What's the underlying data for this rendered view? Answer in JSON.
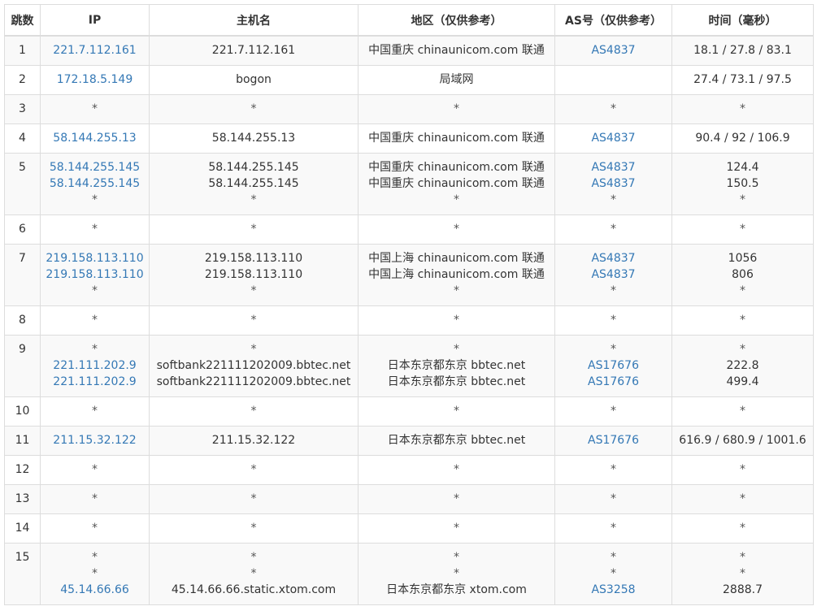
{
  "headers": [
    "跳数",
    "IP",
    "主机名",
    "地区（仅供参考）",
    "AS号（仅供参考）",
    "时间（毫秒）"
  ],
  "rows": [
    {
      "hop": "1",
      "ip": [
        "221.7.112.161"
      ],
      "host": [
        "221.7.112.161"
      ],
      "region": [
        "中国重庆 chinaunicom.com 联通"
      ],
      "as": [
        "AS4837"
      ],
      "time": [
        "18.1 / 27.8 / 83.1"
      ]
    },
    {
      "hop": "2",
      "ip": [
        "172.18.5.149"
      ],
      "host": [
        "bogon"
      ],
      "region": [
        "局域网"
      ],
      "as": [
        ""
      ],
      "time": [
        "27.4 / 73.1 / 97.5"
      ]
    },
    {
      "hop": "3",
      "ip": [
        "*"
      ],
      "host": [
        "*"
      ],
      "region": [
        "*"
      ],
      "as": [
        "*"
      ],
      "time": [
        "*"
      ]
    },
    {
      "hop": "4",
      "ip": [
        "58.144.255.13"
      ],
      "host": [
        "58.144.255.13"
      ],
      "region": [
        "中国重庆 chinaunicom.com 联通"
      ],
      "as": [
        "AS4837"
      ],
      "time": [
        "90.4 / 92 / 106.9"
      ]
    },
    {
      "hop": "5",
      "ip": [
        "58.144.255.145",
        "58.144.255.145",
        "*"
      ],
      "host": [
        "58.144.255.145",
        "58.144.255.145",
        "*"
      ],
      "region": [
        "中国重庆 chinaunicom.com 联通",
        "中国重庆 chinaunicom.com 联通",
        "*"
      ],
      "as": [
        "AS4837",
        "AS4837",
        "*"
      ],
      "time": [
        "124.4",
        "150.5",
        "*"
      ]
    },
    {
      "hop": "6",
      "ip": [
        "*"
      ],
      "host": [
        "*"
      ],
      "region": [
        "*"
      ],
      "as": [
        "*"
      ],
      "time": [
        "*"
      ]
    },
    {
      "hop": "7",
      "ip": [
        "219.158.113.110",
        "219.158.113.110",
        "*"
      ],
      "host": [
        "219.158.113.110",
        "219.158.113.110",
        "*"
      ],
      "region": [
        "中国上海 chinaunicom.com 联通",
        "中国上海 chinaunicom.com 联通",
        "*"
      ],
      "as": [
        "AS4837",
        "AS4837",
        "*"
      ],
      "time": [
        "1056",
        "806",
        "*"
      ]
    },
    {
      "hop": "8",
      "ip": [
        "*"
      ],
      "host": [
        "*"
      ],
      "region": [
        "*"
      ],
      "as": [
        "*"
      ],
      "time": [
        "*"
      ]
    },
    {
      "hop": "9",
      "ip": [
        "*",
        "221.111.202.9",
        "221.111.202.9"
      ],
      "host": [
        "*",
        "softbank221111202009.bbtec.net",
        "softbank221111202009.bbtec.net"
      ],
      "region": [
        "*",
        "日本东京都东京 bbtec.net",
        "日本东京都东京 bbtec.net"
      ],
      "as": [
        "*",
        "AS17676",
        "AS17676"
      ],
      "time": [
        "*",
        "222.8",
        "499.4"
      ]
    },
    {
      "hop": "10",
      "ip": [
        "*"
      ],
      "host": [
        "*"
      ],
      "region": [
        "*"
      ],
      "as": [
        "*"
      ],
      "time": [
        "*"
      ]
    },
    {
      "hop": "11",
      "ip": [
        "211.15.32.122"
      ],
      "host": [
        "211.15.32.122"
      ],
      "region": [
        "日本东京都东京 bbtec.net"
      ],
      "as": [
        "AS17676"
      ],
      "time": [
        "616.9 / 680.9 / 1001.6"
      ]
    },
    {
      "hop": "12",
      "ip": [
        "*"
      ],
      "host": [
        "*"
      ],
      "region": [
        "*"
      ],
      "as": [
        "*"
      ],
      "time": [
        "*"
      ]
    },
    {
      "hop": "13",
      "ip": [
        "*"
      ],
      "host": [
        "*"
      ],
      "region": [
        "*"
      ],
      "as": [
        "*"
      ],
      "time": [
        "*"
      ]
    },
    {
      "hop": "14",
      "ip": [
        "*"
      ],
      "host": [
        "*"
      ],
      "region": [
        "*"
      ],
      "as": [
        "*"
      ],
      "time": [
        "*"
      ]
    },
    {
      "hop": "15",
      "ip": [
        "*",
        "*",
        "45.14.66.66"
      ],
      "host": [
        "*",
        "*",
        "45.14.66.66.static.xtom.com"
      ],
      "region": [
        "*",
        "*",
        "日本东京都东京 xtom.com"
      ],
      "as": [
        "*",
        "*",
        "AS3258"
      ],
      "time": [
        "*",
        "*",
        "2888.7"
      ]
    }
  ]
}
